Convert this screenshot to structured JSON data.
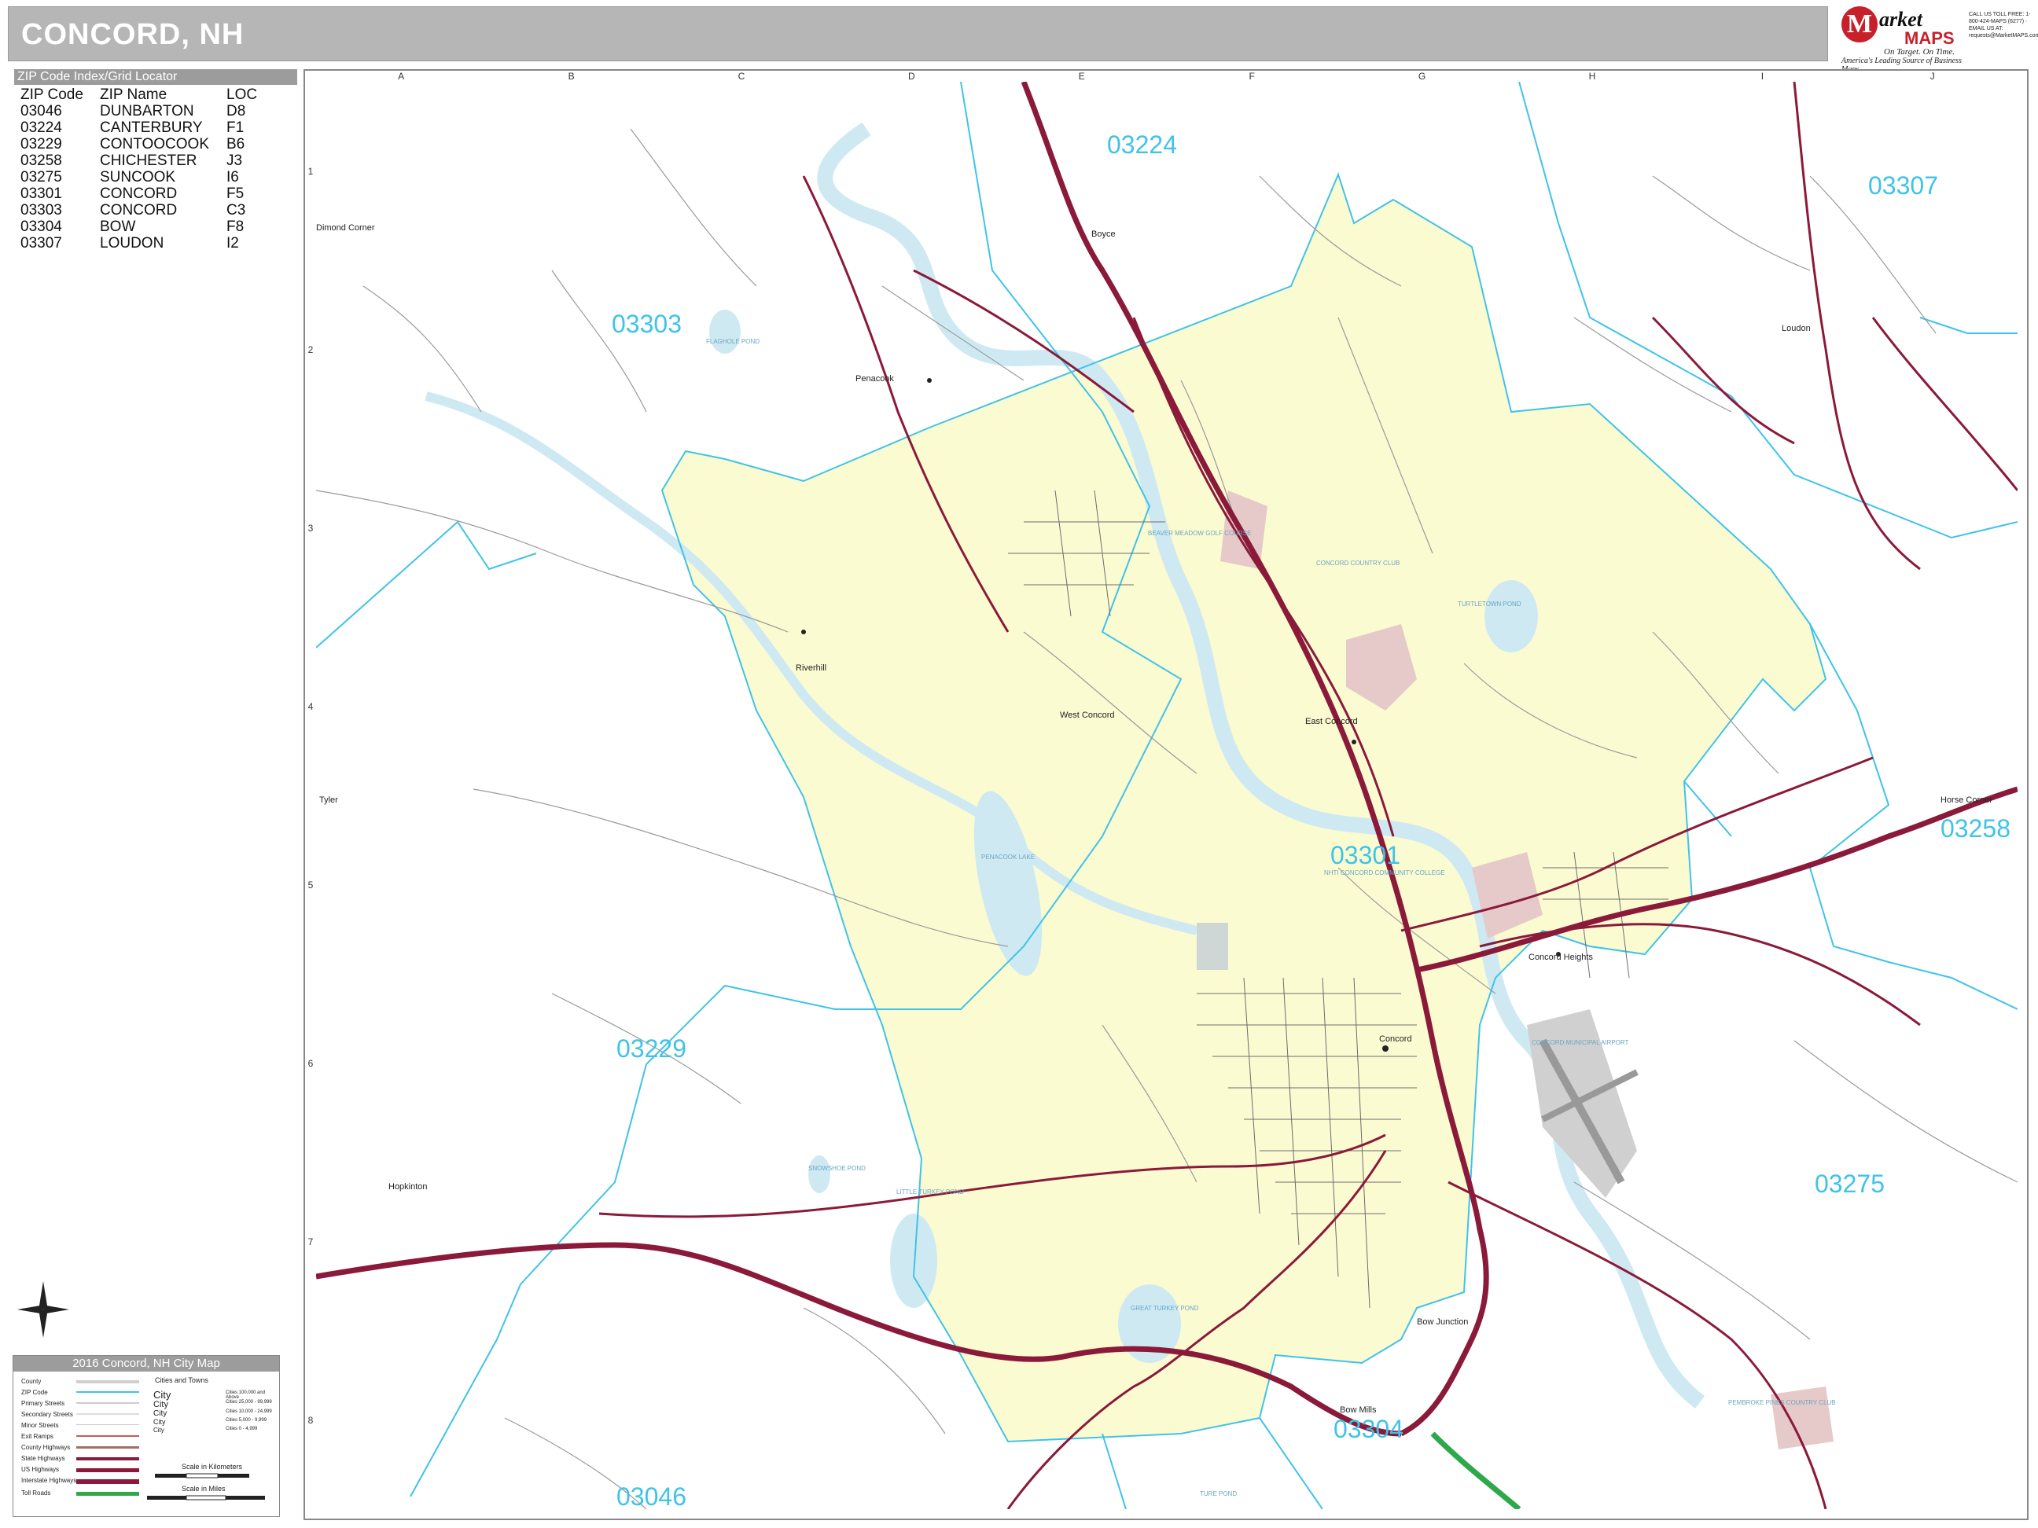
{
  "title": "CONCORD, NH",
  "brand": {
    "m": "M",
    "market": "arket",
    "maps": "MAPS",
    "tag1": "On Target. On Time.",
    "tag2": "America's Leading Source of Business Maps",
    "contact": "CALL US TOLL FREE: 1-800-424-MAPS (6277) · EMAIL US AT: requests@MarketMAPS.com"
  },
  "zip_index": {
    "header": "ZIP Code Index/Grid Locator",
    "columns": [
      "ZIP Code",
      "ZIP Name",
      "LOC"
    ],
    "rows": [
      [
        "03046",
        "DUNBARTON",
        "D8"
      ],
      [
        "03224",
        "CANTERBURY",
        "F1"
      ],
      [
        "03229",
        "CONTOOCOOK",
        "B6"
      ],
      [
        "03258",
        "CHICHESTER",
        "J3"
      ],
      [
        "03275",
        "SUNCOOK",
        "I6"
      ],
      [
        "03301",
        "CONCORD",
        "F5"
      ],
      [
        "03303",
        "CONCORD",
        "C3"
      ],
      [
        "03304",
        "BOW",
        "F8"
      ],
      [
        "03307",
        "LOUDON",
        "I2"
      ]
    ]
  },
  "grid": {
    "columns": [
      "A",
      "B",
      "C",
      "D",
      "E",
      "F",
      "G",
      "H",
      "I",
      "J"
    ],
    "rows": [
      "1",
      "2",
      "3",
      "4",
      "5",
      "6",
      "7",
      "8"
    ]
  },
  "map": {
    "zip_labels": [
      "03224",
      "03307",
      "03303",
      "03301",
      "03258",
      "03229",
      "03275",
      "03304",
      "03046"
    ],
    "places": [
      "Penacook",
      "Riverhill",
      "West Concord",
      "East Concord",
      "Concord",
      "Concord Heights",
      "Bow Junction",
      "Bow Mills",
      "Horse Corner",
      "Hopkinton",
      "Tyler",
      "Loudon",
      "Boyce",
      "Dimond Corner"
    ],
    "water": [
      "PENACOOK LAKE",
      "TURTLETOWN POND",
      "LITTLE TURKEY POND",
      "GREAT TURKEY POND",
      "SNOWSHOE POND",
      "FLAGHOLE POND",
      "TURE POND"
    ],
    "areas": [
      "CONCORD COUNTRY CLUB",
      "BEAVER MEADOW GOLF COURSE",
      "NHTI CONCORD COMMUNITY COLLEGE",
      "CONCORD MUNICIPAL AIRPORT",
      "PEMBROKE PINES COUNTRY CLUB"
    ]
  },
  "map_colors": {
    "city_fill": "#fbfbd2",
    "zip_boundary": "#3fc3e8",
    "interstate": "#8b1a3a",
    "water": "#cfe9f3",
    "golf": "#e6c9c9",
    "airport": "#c8c8c8",
    "toll": "#2fa84a"
  },
  "legend": {
    "title": "2016 Concord, NH City Map",
    "items": [
      "County",
      "ZIP Code",
      "Primary Streets",
      "Secondary Streets",
      "Minor Streets",
      "Exit Ramps",
      "County Highways",
      "State Highways",
      "US Highways",
      "Interstate Highways",
      "Toll Roads"
    ],
    "cities_title": "Cities and Towns",
    "cities": [
      "City",
      "City",
      "City",
      "City",
      "City"
    ],
    "pops": [
      "Cities 100,000 and Above",
      "Cities 25,000 - 99,999",
      "Cities 10,000 - 24,999",
      "Cities 5,000 - 9,999",
      "Cities 0 - 4,999"
    ],
    "scale_km": "Scale in Kilometers",
    "scale_mi": "Scale in Miles"
  }
}
